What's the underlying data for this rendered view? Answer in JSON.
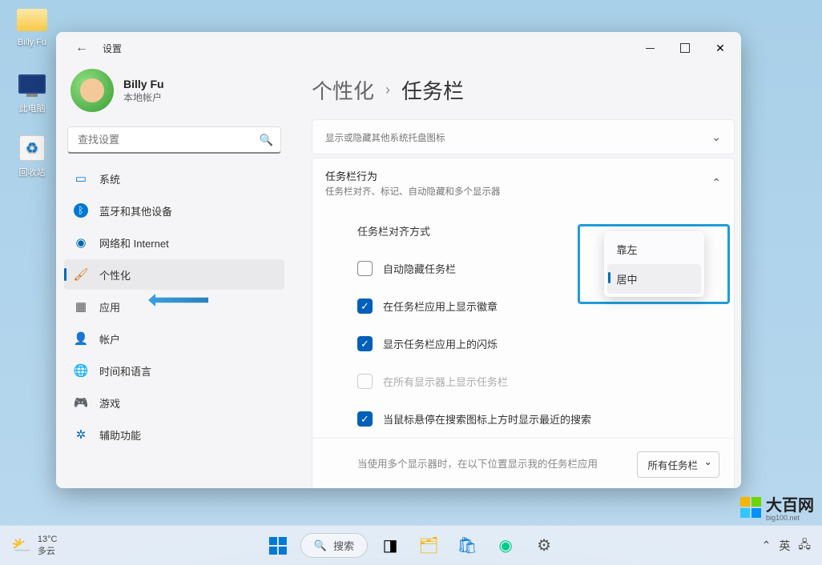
{
  "desktop": {
    "icons": [
      {
        "label": "Billy Fu"
      },
      {
        "label": "此电脑"
      },
      {
        "label": "回收站"
      }
    ]
  },
  "window": {
    "title": "设置",
    "back": "←"
  },
  "user": {
    "name": "Billy Fu",
    "type": "本地帐户"
  },
  "search": {
    "placeholder": "查找设置"
  },
  "nav": [
    {
      "icon": "🖥️",
      "label": "系统",
      "color": "#0078d4"
    },
    {
      "icon": "ᛒ",
      "label": "蓝牙和其他设备",
      "color": "#0078d4"
    },
    {
      "icon": "📶",
      "label": "网络和 Internet",
      "color": "#0aa"
    },
    {
      "icon": "🖌️",
      "label": "个性化",
      "color": "#d06"
    },
    {
      "icon": "▦",
      "label": "应用",
      "color": "#555"
    },
    {
      "icon": "👤",
      "label": "帐户",
      "color": "#0aa"
    },
    {
      "icon": "🌐",
      "label": "时间和语言",
      "color": "#0a8"
    },
    {
      "icon": "🎮",
      "label": "游戏",
      "color": "#888"
    },
    {
      "icon": "♿",
      "label": "辅助功能",
      "color": "#06c"
    }
  ],
  "breadcrumb": {
    "parent": "个性化",
    "current": "任务栏"
  },
  "section_tray": {
    "subtitle": "显示或隐藏其他系统托盘图标"
  },
  "section_behavior": {
    "title": "任务栏行为",
    "subtitle": "任务栏对齐、标记、自动隐藏和多个显示器"
  },
  "alignment_label": "任务栏对齐方式",
  "dropdown": {
    "options": [
      "靠左",
      "居中"
    ]
  },
  "options": [
    {
      "label": "自动隐藏任务栏",
      "checked": false,
      "disabled": false
    },
    {
      "label": "在任务栏应用上显示徽章",
      "checked": true,
      "disabled": false
    },
    {
      "label": "显示任务栏应用上的闪烁",
      "checked": true,
      "disabled": false
    },
    {
      "label": "在所有显示器上显示任务栏",
      "checked": false,
      "disabled": true
    },
    {
      "label": "当鼠标悬停在搜索图标上方时显示最近的搜索",
      "checked": true,
      "disabled": false
    }
  ],
  "multi": {
    "text": "当使用多个显示器时，在以下位置显示我的任务栏应用",
    "select": "所有任务栏"
  },
  "taskbar": {
    "weather": {
      "temp": "13°C",
      "cond": "多云"
    },
    "search": "搜索",
    "lang": "英"
  },
  "watermark": {
    "brand": "大百网",
    "url": "big100.net"
  }
}
